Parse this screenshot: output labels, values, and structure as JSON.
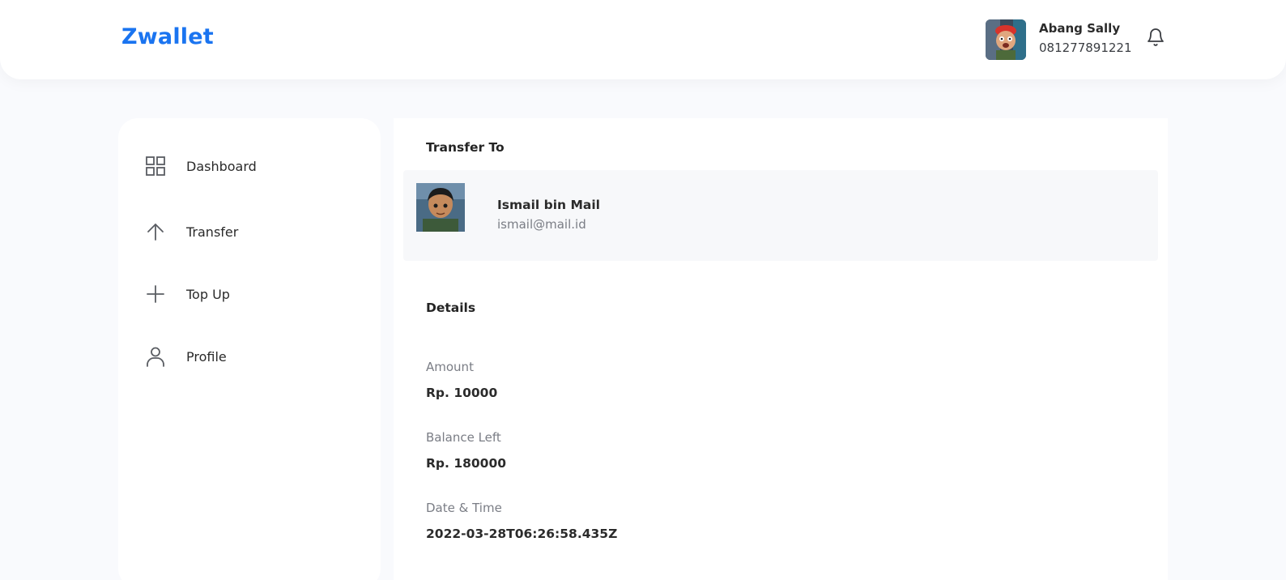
{
  "app": {
    "brand": "Zwallet"
  },
  "header": {
    "user_name": "Abang Sally",
    "user_phone": "081277891221",
    "avatar_icon": "user-avatar-photo",
    "notification_icon": "bell-icon"
  },
  "sidebar": {
    "items": [
      {
        "label": "Dashboard",
        "icon": "grid-icon"
      },
      {
        "label": "Transfer",
        "icon": "arrow-up-icon"
      },
      {
        "label": "Top Up",
        "icon": "plus-icon"
      },
      {
        "label": "Profile",
        "icon": "user-icon"
      }
    ]
  },
  "main": {
    "transfer_to_title": "Transfer To",
    "recipient": {
      "name": "Ismail bin Mail",
      "email": "ismail@mail.id"
    },
    "details_title": "Details",
    "details": [
      {
        "label": "Amount",
        "value": "Rp. 10000"
      },
      {
        "label": "Balance Left",
        "value": "Rp. 180000"
      },
      {
        "label": "Date & Time",
        "value": "2022-03-28T06:26:58.435Z"
      }
    ]
  },
  "colors": {
    "brand": "#1a74f0",
    "background": "#f9fafd",
    "card": "#ffffff",
    "recipient_card": "#f7f8fa"
  }
}
